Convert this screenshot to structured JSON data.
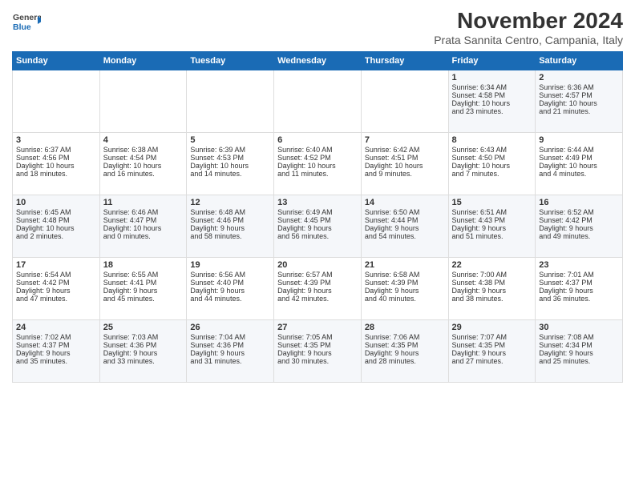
{
  "header": {
    "logo_general": "General",
    "logo_blue": "Blue",
    "month_title": "November 2024",
    "subtitle": "Prata Sannita Centro, Campania, Italy"
  },
  "columns": [
    "Sunday",
    "Monday",
    "Tuesday",
    "Wednesday",
    "Thursday",
    "Friday",
    "Saturday"
  ],
  "weeks": [
    {
      "days": [
        {
          "num": "",
          "content": ""
        },
        {
          "num": "",
          "content": ""
        },
        {
          "num": "",
          "content": ""
        },
        {
          "num": "",
          "content": ""
        },
        {
          "num": "",
          "content": ""
        },
        {
          "num": "1",
          "content": "Sunrise: 6:34 AM\nSunset: 4:58 PM\nDaylight: 10 hours\nand 23 minutes."
        },
        {
          "num": "2",
          "content": "Sunrise: 6:36 AM\nSunset: 4:57 PM\nDaylight: 10 hours\nand 21 minutes."
        }
      ]
    },
    {
      "days": [
        {
          "num": "3",
          "content": "Sunrise: 6:37 AM\nSunset: 4:56 PM\nDaylight: 10 hours\nand 18 minutes."
        },
        {
          "num": "4",
          "content": "Sunrise: 6:38 AM\nSunset: 4:54 PM\nDaylight: 10 hours\nand 16 minutes."
        },
        {
          "num": "5",
          "content": "Sunrise: 6:39 AM\nSunset: 4:53 PM\nDaylight: 10 hours\nand 14 minutes."
        },
        {
          "num": "6",
          "content": "Sunrise: 6:40 AM\nSunset: 4:52 PM\nDaylight: 10 hours\nand 11 minutes."
        },
        {
          "num": "7",
          "content": "Sunrise: 6:42 AM\nSunset: 4:51 PM\nDaylight: 10 hours\nand 9 minutes."
        },
        {
          "num": "8",
          "content": "Sunrise: 6:43 AM\nSunset: 4:50 PM\nDaylight: 10 hours\nand 7 minutes."
        },
        {
          "num": "9",
          "content": "Sunrise: 6:44 AM\nSunset: 4:49 PM\nDaylight: 10 hours\nand 4 minutes."
        }
      ]
    },
    {
      "days": [
        {
          "num": "10",
          "content": "Sunrise: 6:45 AM\nSunset: 4:48 PM\nDaylight: 10 hours\nand 2 minutes."
        },
        {
          "num": "11",
          "content": "Sunrise: 6:46 AM\nSunset: 4:47 PM\nDaylight: 10 hours\nand 0 minutes."
        },
        {
          "num": "12",
          "content": "Sunrise: 6:48 AM\nSunset: 4:46 PM\nDaylight: 9 hours\nand 58 minutes."
        },
        {
          "num": "13",
          "content": "Sunrise: 6:49 AM\nSunset: 4:45 PM\nDaylight: 9 hours\nand 56 minutes."
        },
        {
          "num": "14",
          "content": "Sunrise: 6:50 AM\nSunset: 4:44 PM\nDaylight: 9 hours\nand 54 minutes."
        },
        {
          "num": "15",
          "content": "Sunrise: 6:51 AM\nSunset: 4:43 PM\nDaylight: 9 hours\nand 51 minutes."
        },
        {
          "num": "16",
          "content": "Sunrise: 6:52 AM\nSunset: 4:42 PM\nDaylight: 9 hours\nand 49 minutes."
        }
      ]
    },
    {
      "days": [
        {
          "num": "17",
          "content": "Sunrise: 6:54 AM\nSunset: 4:42 PM\nDaylight: 9 hours\nand 47 minutes."
        },
        {
          "num": "18",
          "content": "Sunrise: 6:55 AM\nSunset: 4:41 PM\nDaylight: 9 hours\nand 45 minutes."
        },
        {
          "num": "19",
          "content": "Sunrise: 6:56 AM\nSunset: 4:40 PM\nDaylight: 9 hours\nand 44 minutes."
        },
        {
          "num": "20",
          "content": "Sunrise: 6:57 AM\nSunset: 4:39 PM\nDaylight: 9 hours\nand 42 minutes."
        },
        {
          "num": "21",
          "content": "Sunrise: 6:58 AM\nSunset: 4:39 PM\nDaylight: 9 hours\nand 40 minutes."
        },
        {
          "num": "22",
          "content": "Sunrise: 7:00 AM\nSunset: 4:38 PM\nDaylight: 9 hours\nand 38 minutes."
        },
        {
          "num": "23",
          "content": "Sunrise: 7:01 AM\nSunset: 4:37 PM\nDaylight: 9 hours\nand 36 minutes."
        }
      ]
    },
    {
      "days": [
        {
          "num": "24",
          "content": "Sunrise: 7:02 AM\nSunset: 4:37 PM\nDaylight: 9 hours\nand 35 minutes."
        },
        {
          "num": "25",
          "content": "Sunrise: 7:03 AM\nSunset: 4:36 PM\nDaylight: 9 hours\nand 33 minutes."
        },
        {
          "num": "26",
          "content": "Sunrise: 7:04 AM\nSunset: 4:36 PM\nDaylight: 9 hours\nand 31 minutes."
        },
        {
          "num": "27",
          "content": "Sunrise: 7:05 AM\nSunset: 4:35 PM\nDaylight: 9 hours\nand 30 minutes."
        },
        {
          "num": "28",
          "content": "Sunrise: 7:06 AM\nSunset: 4:35 PM\nDaylight: 9 hours\nand 28 minutes."
        },
        {
          "num": "29",
          "content": "Sunrise: 7:07 AM\nSunset: 4:35 PM\nDaylight: 9 hours\nand 27 minutes."
        },
        {
          "num": "30",
          "content": "Sunrise: 7:08 AM\nSunset: 4:34 PM\nDaylight: 9 hours\nand 25 minutes."
        }
      ]
    }
  ]
}
